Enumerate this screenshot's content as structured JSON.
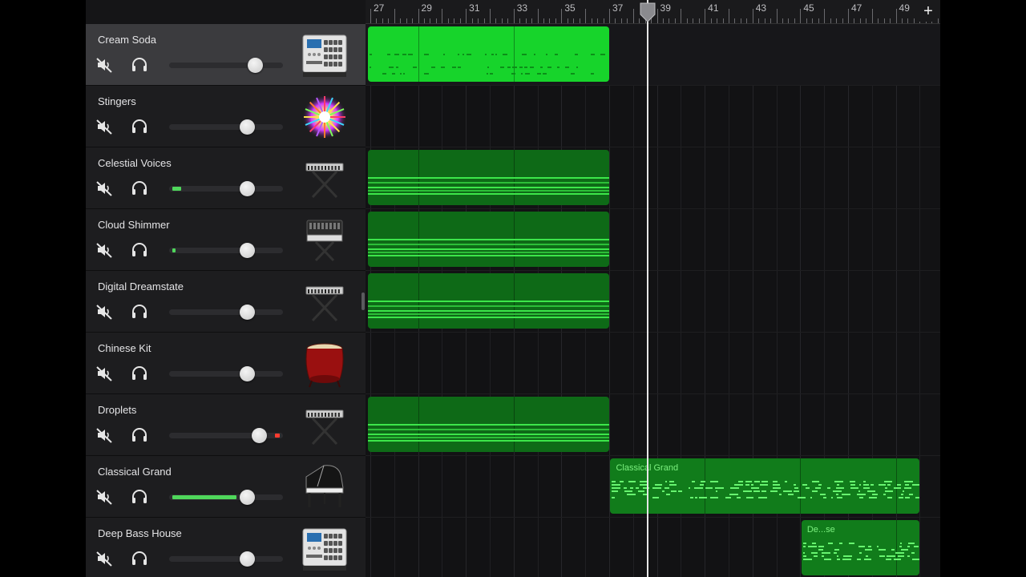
{
  "tracks": [
    {
      "name": "Cream Soda",
      "instrument": "drum-machine-icon",
      "selected": true,
      "volume": 0.75,
      "meter": 0
    },
    {
      "name": "Stingers",
      "instrument": "burst-icon",
      "selected": false,
      "volume": 0.68,
      "meter": 0
    },
    {
      "name": "Celestial Voices",
      "instrument": "keyboard-stand-icon",
      "selected": false,
      "volume": 0.68,
      "meter": 0.08
    },
    {
      "name": "Cloud Shimmer",
      "instrument": "synth-keyboard-icon",
      "selected": false,
      "volume": 0.68,
      "meter": 0.03
    },
    {
      "name": "Digital Dreamstate",
      "instrument": "keyboard-stand-icon",
      "selected": false,
      "volume": 0.68,
      "meter": 0
    },
    {
      "name": "Chinese Kit",
      "instrument": "chinese-drum-icon",
      "selected": false,
      "volume": 0.68,
      "meter": 0
    },
    {
      "name": "Droplets",
      "instrument": "keyboard-stand-icon",
      "selected": false,
      "volume": 0.79,
      "meter": 0,
      "clip": true
    },
    {
      "name": "Classical Grand",
      "instrument": "grand-piano-icon",
      "selected": false,
      "volume": 0.68,
      "meter": 0.56
    },
    {
      "name": "Deep Bass House",
      "instrument": "drum-machine-icon",
      "selected": false,
      "volume": 0.68,
      "meter": 0
    }
  ],
  "ruler": {
    "bar_labels": [
      "27",
      "29",
      "31",
      "33",
      "35",
      "37",
      "39",
      "41",
      "43",
      "45",
      "47",
      "49"
    ]
  },
  "regions": [
    {
      "track": 0,
      "start_bar": 26.9,
      "end_bar": 37.0,
      "style": "bright",
      "label": ""
    },
    {
      "track": 2,
      "start_bar": 26.9,
      "end_bar": 37.0,
      "style": "normal",
      "label": ""
    },
    {
      "track": 3,
      "start_bar": 26.9,
      "end_bar": 37.0,
      "style": "normal",
      "label": ""
    },
    {
      "track": 4,
      "start_bar": 26.9,
      "end_bar": 37.0,
      "style": "normal",
      "label": ""
    },
    {
      "track": 6,
      "start_bar": 26.9,
      "end_bar": 37.0,
      "style": "normal",
      "label": ""
    },
    {
      "track": 7,
      "start_bar": 37.05,
      "end_bar": 50.0,
      "style": "highlight",
      "label": "Classical Grand"
    },
    {
      "track": 8,
      "start_bar": 45.05,
      "end_bar": 50.0,
      "style": "highlight",
      "label": "De...se"
    }
  ],
  "playhead_bar": 38.6,
  "add_button_label": "+",
  "colors": {
    "region_dark": "#0e6a17",
    "region_bright": "#17d42b",
    "note": "#3ce64a",
    "meter": "#4fd75b",
    "clip": "#ff3b2f"
  }
}
